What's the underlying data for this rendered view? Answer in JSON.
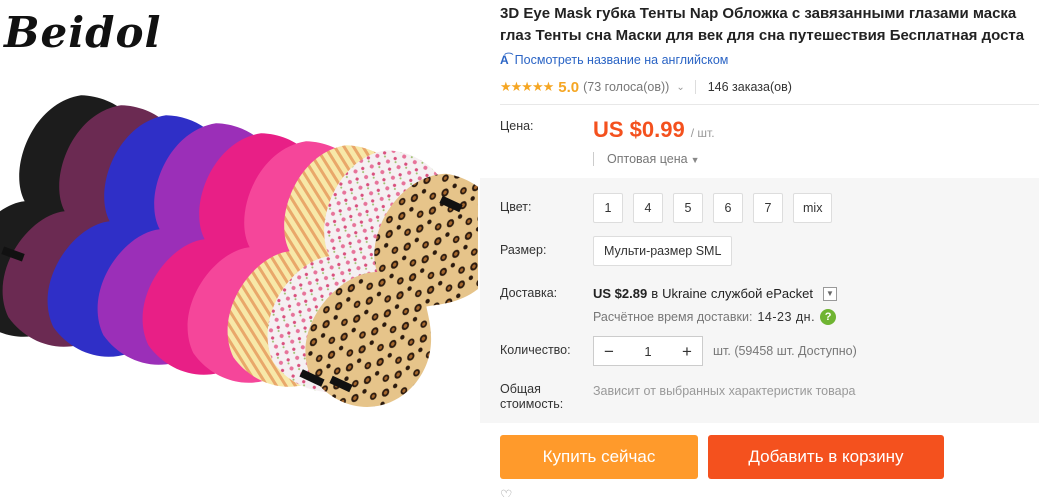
{
  "brand": "Beidol",
  "product": {
    "title_line1": "3D Eye Mask губка Тенты Nap Обложка с завязанными глазами маска",
    "title_line2": "глаз Тенты сна Маски для век для сна путешествия Бесплатная доста",
    "translate_link": "Посмотреть название на английском",
    "rating": {
      "stars": "★★★★★",
      "score": "5.0",
      "votes": "(73 голоса(ов))",
      "orders": "146 заказа(ов)"
    },
    "price": {
      "label": "Цена:",
      "amount": "US $0.99",
      "unit": "/ шт.",
      "wholesale": "Оптовая цена"
    },
    "color": {
      "label": "Цвет:",
      "options": [
        "1",
        "4",
        "5",
        "6",
        "7",
        "mix"
      ]
    },
    "size": {
      "label": "Размер:",
      "option": "Мульти-размер SML"
    },
    "shipping": {
      "label": "Доставка:",
      "cost": "US $2.89",
      "to": "в",
      "country": "Ukraine",
      "service": "службой ePacket",
      "eta_label": "Расчётное время доставки:",
      "eta_days": "14-23 дн."
    },
    "quantity": {
      "label": "Количество:",
      "value": "1",
      "note": "шт. (59458 шт. Доступно)"
    },
    "total": {
      "label_line1": "Общая",
      "label_line2": "стоимость:",
      "note": "Зависит от выбранных характеристик товара"
    },
    "buttons": {
      "buy_now": "Купить сейчас",
      "add_to_cart": "Добавить в корзину"
    }
  },
  "colors": {
    "price_orange": "#f4511e",
    "buy_button": "#ff9a2b",
    "cart_button": "#f4511e",
    "link_blue": "#2a64c5",
    "star_gold": "#f5a623"
  }
}
